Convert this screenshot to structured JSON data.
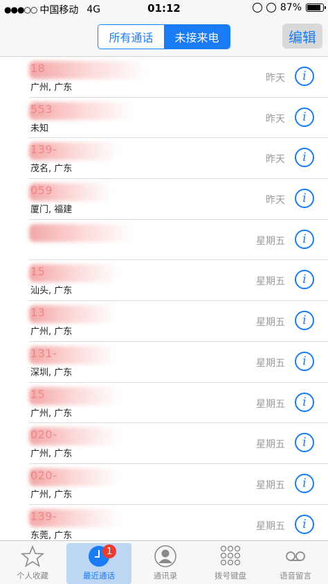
{
  "status_bar": {
    "signal": "●●●○○",
    "carrier": "中国移动",
    "network": "4G",
    "time": "01:12",
    "battery": "87%"
  },
  "nav": {
    "segments": [
      "所有通话",
      "未接来电"
    ],
    "selected_segment": "未接来电",
    "edit_label": "编辑"
  },
  "calls": [
    {
      "number": "18",
      "location": "广州, 广东",
      "when": "昨天"
    },
    {
      "number": "553",
      "location": "未知",
      "when": "昨天"
    },
    {
      "number": "139-",
      "location": "茂名, 广东",
      "when": "昨天"
    },
    {
      "number": "059",
      "location": "厦门, 福建",
      "when": "昨天"
    },
    {
      "number": "",
      "location": "",
      "when": "星期五"
    },
    {
      "number": "15",
      "location": "汕头, 广东",
      "when": "星期五"
    },
    {
      "number": "13",
      "location": "广州, 广东",
      "when": "星期五"
    },
    {
      "number": "131-",
      "location": "深圳, 广东",
      "when": "星期五"
    },
    {
      "number": "15",
      "location": "广州, 广东",
      "when": "星期五"
    },
    {
      "number": "020-",
      "location": "广州, 广东",
      "when": "星期五"
    },
    {
      "number": "020-",
      "location": "广州, 广东",
      "when": "星期五"
    },
    {
      "number": "139-",
      "location": "东莞, 广东",
      "when": "星期五"
    }
  ],
  "tabs": [
    {
      "label": "个人收藏",
      "icon": "star-icon"
    },
    {
      "label": "最近通话",
      "icon": "clock-icon",
      "badge": "1"
    },
    {
      "label": "通讯录",
      "icon": "contact-icon"
    },
    {
      "label": "拨号键盘",
      "icon": "keypad-icon"
    },
    {
      "label": "语音留言",
      "icon": "voicemail-icon"
    }
  ],
  "colors": {
    "accent": "#1a7cf5",
    "missed": "#e0392d",
    "badge": "#ef3b2f"
  }
}
